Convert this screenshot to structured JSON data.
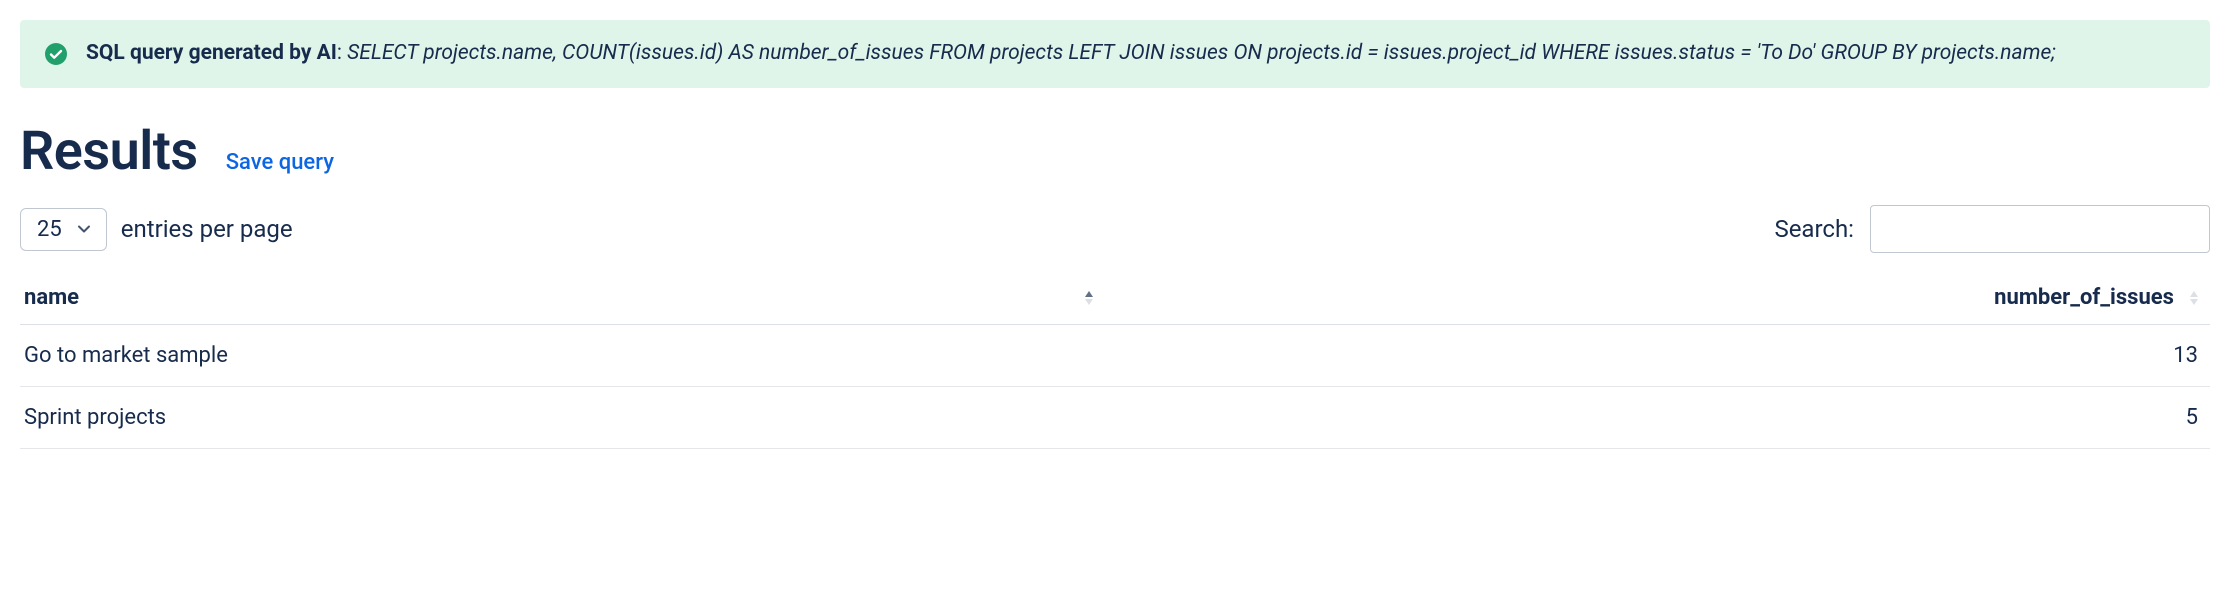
{
  "alert": {
    "label": "SQL query generated by AI",
    "separator": ": ",
    "query": "SELECT projects.name, COUNT(issues.id) AS number_of_issues FROM projects LEFT JOIN issues ON projects.id = issues.project_id WHERE issues.status = 'To Do' GROUP BY projects.name;"
  },
  "header": {
    "title": "Results",
    "save_query": "Save query"
  },
  "controls": {
    "page_size": "25",
    "entries_label": "entries per page",
    "search_label": "Search:",
    "search_value": ""
  },
  "table": {
    "columns": {
      "name": "name",
      "issues": "number_of_issues"
    },
    "rows": [
      {
        "name": "Go to market sample",
        "issues": "13"
      },
      {
        "name": "Sprint projects",
        "issues": "5"
      }
    ]
  }
}
